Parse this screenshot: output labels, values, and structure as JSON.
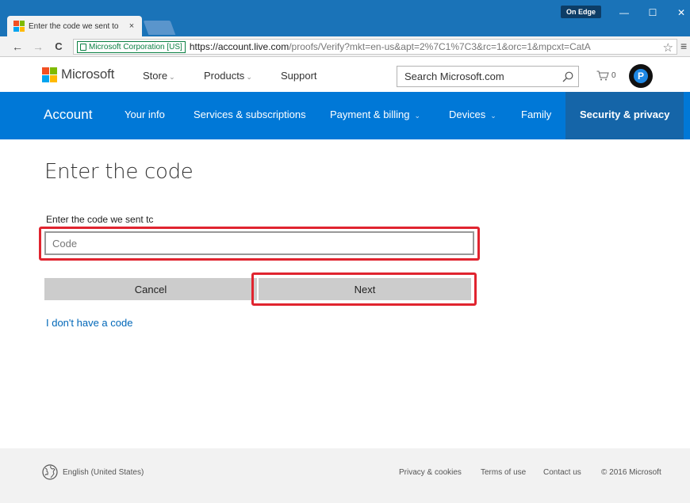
{
  "browser": {
    "tab_title": "Enter the code we sent to",
    "tab_close": "×",
    "profile_badge": "On Edge",
    "window_minimize": "—",
    "window_maximize": "☐",
    "window_close": "✕",
    "back": "←",
    "forward": "→",
    "reload": "C",
    "ev_label": "Microsoft Corporation [US]",
    "url_host": "https://account.live.com",
    "url_path": "/proofs/Verify?mkt=en-us&apt=2%7C1%7C3&rc=1&orc=1&mpcxt=CatA",
    "star": "☆",
    "menu": "≡"
  },
  "header": {
    "brand": "Microsoft",
    "nav": [
      {
        "label": "Store",
        "chevron": "⌄"
      },
      {
        "label": "Products",
        "chevron": "⌄"
      },
      {
        "label": "Support",
        "chevron": ""
      }
    ],
    "search_placeholder": "Search Microsoft.com",
    "cart_count": "0",
    "avatar_letter": "P"
  },
  "account_nav": {
    "brand": "Account",
    "items": [
      {
        "label": "Your info",
        "chevron": ""
      },
      {
        "label": "Services & subscriptions",
        "chevron": ""
      },
      {
        "label": "Payment & billing",
        "chevron": "⌄"
      },
      {
        "label": "Devices",
        "chevron": "⌄"
      },
      {
        "label": "Family",
        "chevron": ""
      },
      {
        "label": "Security & privacy",
        "chevron": ""
      }
    ]
  },
  "main": {
    "title": "Enter the code",
    "field_label": "Enter the code we sent tc",
    "code_placeholder": "Code",
    "cancel_label": "Cancel",
    "next_label": "Next",
    "no_code_link": "I don't have a code"
  },
  "footer": {
    "locale": "English (United States)",
    "links": [
      "Privacy & cookies",
      "Terms of use",
      "Contact us"
    ],
    "copyright": "© 2016 Microsoft"
  },
  "colors": {
    "account_blue": "#0078d7",
    "active_tab": "#1565a8",
    "highlight_red": "#e0242f",
    "link_blue": "#0067b8"
  }
}
